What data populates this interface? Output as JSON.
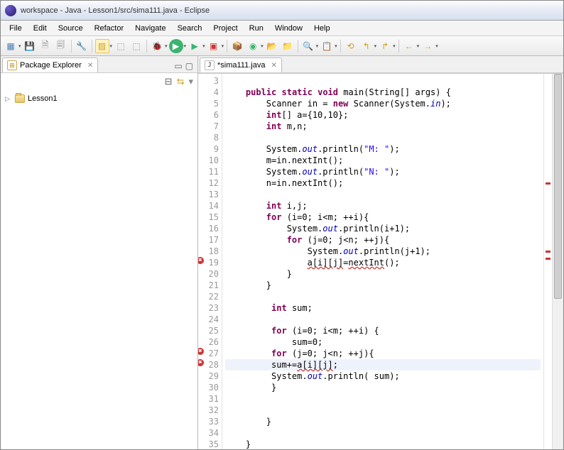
{
  "window": {
    "title": "workspace - Java - Lesson1/src/sima111.java - Eclipse"
  },
  "menu": {
    "items": [
      "File",
      "Edit",
      "Source",
      "Refactor",
      "Navigate",
      "Search",
      "Project",
      "Run",
      "Window",
      "Help"
    ]
  },
  "toolbar": {
    "new": "▤",
    "save": "💾",
    "saveall1": "🗎",
    "saveall2": "🗐",
    "sep": "|",
    "debugtool": "🔧",
    "wand": "▨",
    "ext": "⬚",
    "debug": "🐞",
    "run": "▶",
    "runext": "▶",
    "coverage": "▣",
    "newpkg": "📦",
    "newclass": "◆",
    "openfolder": "📂",
    "openfile": "📄",
    "search": "🔍",
    "task": "📋",
    "back": "↶",
    "fwd": "↷",
    "last": "⟲",
    "next": "→",
    "prev": "←"
  },
  "explorer": {
    "title": "Package Explorer",
    "project": "Lesson1"
  },
  "editor": {
    "tab": "*sima111.java",
    "startLine": 3,
    "lines": [
      {
        "n": 3,
        "t": ""
      },
      {
        "n": 4,
        "t": "    public static void main(String[] args) {"
      },
      {
        "n": 5,
        "t": "        Scanner in = new Scanner(System.in);"
      },
      {
        "n": 6,
        "t": "        int[] a={10,10};"
      },
      {
        "n": 7,
        "t": "        int m,n;"
      },
      {
        "n": 8,
        "t": ""
      },
      {
        "n": 9,
        "t": "        System.out.println(\"M: \");"
      },
      {
        "n": 10,
        "t": "        m=in.nextInt();"
      },
      {
        "n": 11,
        "t": "        System.out.println(\"N: \");"
      },
      {
        "n": 12,
        "t": "        n=in.nextInt();"
      },
      {
        "n": 13,
        "t": ""
      },
      {
        "n": 14,
        "t": "        int i,j;"
      },
      {
        "n": 15,
        "t": "        for (i=0; i<m; ++i){"
      },
      {
        "n": 16,
        "t": "            System.out.println(i+1);"
      },
      {
        "n": 17,
        "t": "            for (j=0; j<n; ++j){"
      },
      {
        "n": 18,
        "t": "                System.out.println(j+1);"
      },
      {
        "n": 19,
        "t": "                a[i][j]=nextInt();",
        "mark": "error"
      },
      {
        "n": 20,
        "t": "            }"
      },
      {
        "n": 21,
        "t": "        }"
      },
      {
        "n": 22,
        "t": ""
      },
      {
        "n": 23,
        "t": "         int sum;"
      },
      {
        "n": 24,
        "t": ""
      },
      {
        "n": 25,
        "t": "         for (i=0; i<m; ++i) {"
      },
      {
        "n": 26,
        "t": "             sum=0;"
      },
      {
        "n": 27,
        "t": "         for (j=0; j<n; ++j){",
        "mark": "error"
      },
      {
        "n": 28,
        "t": "         sum+=a[i][j];",
        "mark": "error",
        "hl": true
      },
      {
        "n": 29,
        "t": "         System.out.println( sum);"
      },
      {
        "n": 30,
        "t": "         }"
      },
      {
        "n": 31,
        "t": ""
      },
      {
        "n": 32,
        "t": ""
      },
      {
        "n": 33,
        "t": "        }"
      },
      {
        "n": 34,
        "t": ""
      },
      {
        "n": 35,
        "t": "    }"
      }
    ]
  }
}
